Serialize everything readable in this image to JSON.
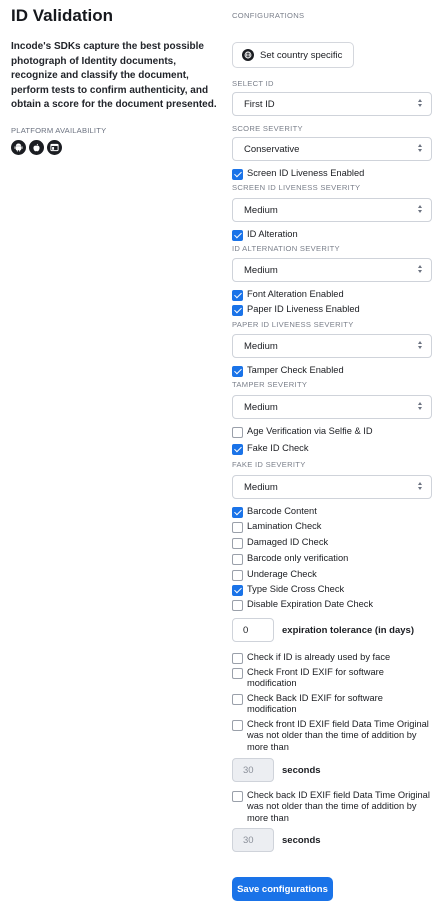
{
  "page": {
    "title": "ID Validation",
    "description": "Incode's SDKs capture the best possible photograph of Identity documents, recognize and classify the document, perform tests to confirm authenticity, and obtain a score for the document presented.",
    "platform_label": "PLATFORM AVAILABILITY",
    "platforms": [
      {
        "name": "android-icon"
      },
      {
        "name": "apple-icon"
      },
      {
        "name": "web-icon"
      }
    ]
  },
  "config": {
    "header": "CONFIGURATIONS",
    "country_button": "Set country specific",
    "select_id": {
      "label": "SELECT ID",
      "value": "First ID"
    },
    "score_severity": {
      "label": "SCORE SEVERITY",
      "value": "Conservative"
    },
    "screen_id_liveness": {
      "check": "Screen ID Liveness Enabled",
      "checked": true,
      "label": "SCREEN ID LIVENESS SEVERITY",
      "value": "Medium"
    },
    "id_alteration": {
      "check": "ID Alteration",
      "checked": true,
      "label": "ID ALTERNATION SEVERITY",
      "value": "Medium"
    },
    "font_alteration": {
      "check": "Font Alteration Enabled",
      "checked": true
    },
    "paper_id_liveness": {
      "check": "Paper ID Liveness Enabled",
      "checked": true,
      "label": "PAPER ID LIVENESS SEVERITY",
      "value": "Medium"
    },
    "tamper_check": {
      "check": "Tamper Check Enabled",
      "checked": true,
      "label": "TAMPER SEVERITY",
      "value": "Medium"
    },
    "age_verification": {
      "check": "Age Verification via Selfie & ID",
      "checked": false
    },
    "fake_id": {
      "check": "Fake ID Check",
      "checked": true,
      "label": "FAKE ID SEVERITY",
      "value": "Medium"
    },
    "barcode_content": {
      "check": "Barcode Content",
      "checked": true
    },
    "lamination": {
      "check": "Lamination Check",
      "checked": false
    },
    "damaged_id": {
      "check": "Damaged ID Check",
      "checked": false
    },
    "barcode_only": {
      "check": "Barcode only verification",
      "checked": false
    },
    "underage": {
      "check": "Underage Check",
      "checked": false
    },
    "type_side": {
      "check": "Type Side Cross Check",
      "checked": true
    },
    "disable_expiration": {
      "check": "Disable Expiration Date Check",
      "checked": false
    },
    "expiration": {
      "value": "0",
      "label": "expiration tolerance (in days)"
    },
    "used_by_face": {
      "check": "Check if ID is already used by face",
      "checked": false
    },
    "front_exif": {
      "check": "Check Front ID EXIF for software modification",
      "checked": false
    },
    "back_exif": {
      "check": "Check Back ID EXIF for software modification",
      "checked": false
    },
    "front_datetime": {
      "check": "Check front ID EXIF field Data Time Original was not older than the time of addition by more than",
      "checked": false,
      "value": "30",
      "unit": "seconds"
    },
    "back_datetime": {
      "check": "Check back ID EXIF field Data Time Original was not older than the time of addition by more than",
      "checked": false,
      "value": "30",
      "unit": "seconds"
    },
    "save_button": "Save configurations"
  }
}
